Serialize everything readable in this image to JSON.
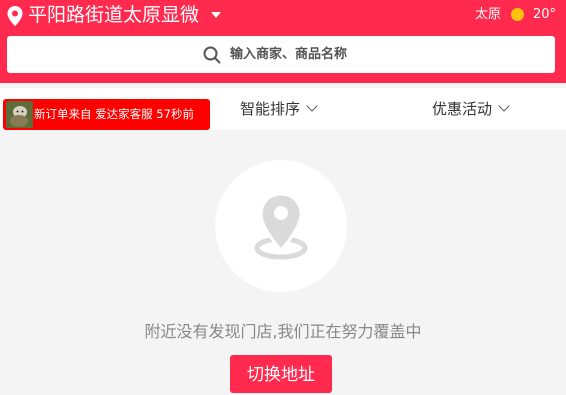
{
  "header": {
    "location": "平阳路街道太原显微",
    "weather": {
      "city": "太原",
      "temperature": "20°",
      "icon": "sun-icon"
    },
    "search_placeholder": "输入商家、商品名称"
  },
  "notice": {
    "text": "新订单来自 爱达家客服 57秒前"
  },
  "filters": {
    "sort_label": "智能排序",
    "promo_label": "优惠活动"
  },
  "empty": {
    "message": "附近没有发现门店,我们正在努力覆盖中",
    "button_label": "切换地址"
  },
  "colors": {
    "brand": "#ff2a4e",
    "notice_bg": "#ff0000",
    "sun": "#ffc20e"
  }
}
